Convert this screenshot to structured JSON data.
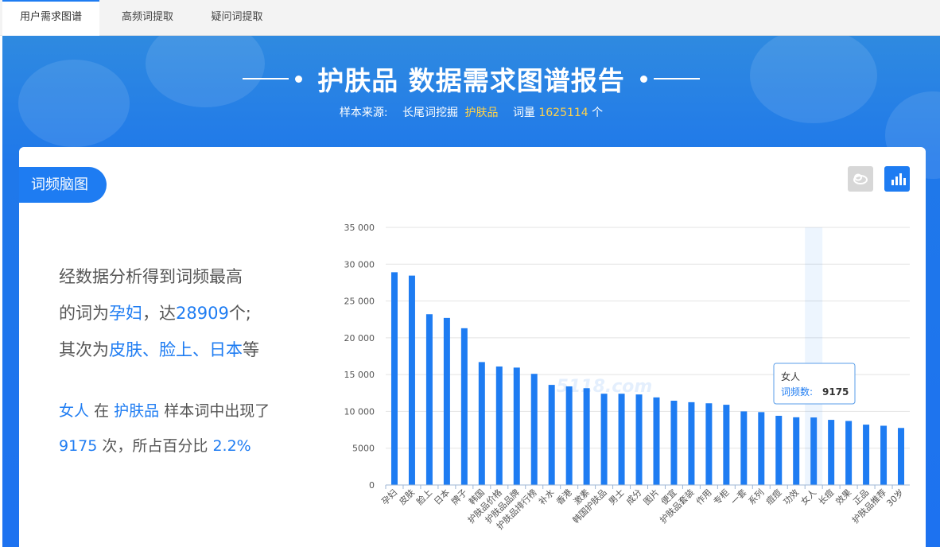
{
  "tabs": [
    {
      "label": "用户需求图谱",
      "active": true
    },
    {
      "label": "高频词提取",
      "active": false
    },
    {
      "label": "疑问词提取",
      "active": false
    }
  ],
  "header": {
    "title": "护肤品 数据需求图谱报告",
    "source_label": "样本来源:",
    "source_value": "长尾词挖掘",
    "keyword": "护肤品",
    "count_label": "词量",
    "count_value": "1625114",
    "count_unit": "个"
  },
  "section": {
    "label": "词频脑图"
  },
  "toolbar": {
    "cloud_icon": "cloud-icon",
    "bar_icon": "bar-chart-icon"
  },
  "summary": {
    "line1": "经数据分析得到词频最高",
    "line2_a": "的词为",
    "top_word": "孕妇",
    "line2_b": "，达",
    "top_count": "28909",
    "line2_c": "个;",
    "line3_a": "其次为",
    "second_words": "皮肤、脸上、日本",
    "line3_b": "等"
  },
  "summary2": {
    "word": "女人",
    "in": "在",
    "keyword": "护肤品",
    "text1": "样本词中出现了",
    "count": "9175",
    "text2": "次，所占百分比",
    "percent": "2.2%"
  },
  "watermark": "5118.com",
  "tooltip": {
    "title": "女人",
    "label": "词频数:",
    "value": "9175"
  },
  "colors": {
    "accent": "#1e7cf2",
    "highlight": "#ffd24a",
    "bar": "#1e7cf2"
  },
  "chart_data": {
    "type": "bar",
    "categories": [
      "孕妇",
      "皮肤",
      "脸上",
      "日本",
      "牌子",
      "韩国",
      "护肤品价格",
      "护肤品品牌",
      "护肤品排行榜",
      "补水",
      "香港",
      "激素",
      "韩国护肤品",
      "男士",
      "成分",
      "图片",
      "便宜",
      "护肤品套装",
      "作用",
      "专柜",
      "一套",
      "系列",
      "痘痘",
      "功效",
      "女人",
      "长痘",
      "效果",
      "正品",
      "护肤品推荐",
      "30岁"
    ],
    "values": [
      28909,
      28450,
      23200,
      22700,
      21300,
      16700,
      16100,
      15950,
      15100,
      13600,
      13400,
      13150,
      12400,
      12400,
      12300,
      11900,
      11450,
      11250,
      11100,
      10900,
      10000,
      9900,
      9400,
      9200,
      9175,
      8850,
      8700,
      8200,
      8050,
      7750
    ],
    "yticks": [
      "0",
      "5000",
      "10 000",
      "15 000",
      "20 000",
      "25 000",
      "30 000",
      "35 000"
    ],
    "ylim": [
      0,
      35000
    ],
    "grid": true,
    "highlight_category": "女人"
  }
}
